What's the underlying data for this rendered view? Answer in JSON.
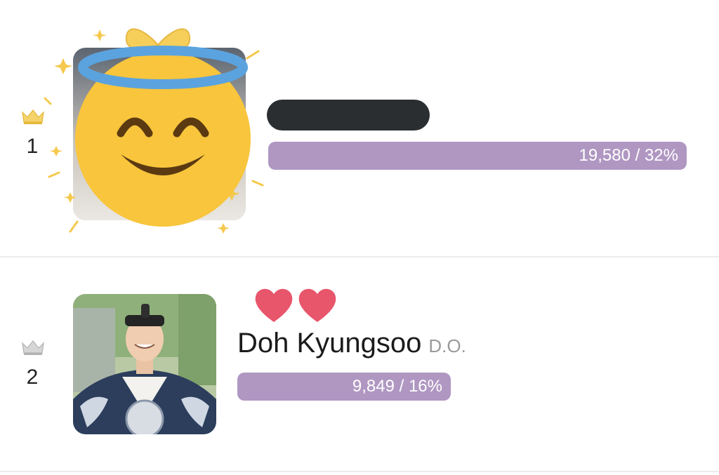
{
  "ranking": [
    {
      "rank": "1",
      "crown_icon": "gold-crown-icon",
      "crown_color": "#f2c94c",
      "name_hidden": true,
      "photo_overlay": "smiling-face-with-halo-emoji",
      "votes_text": "19,580 / 32%",
      "percent": 32
    },
    {
      "rank": "2",
      "crown_icon": "silver-crown-icon",
      "crown_color": "#c4c4c4",
      "name": "Doh Kyungsoo",
      "stage_name": "D.O.",
      "decoration": "two-hearts-icon",
      "votes_text": "9,849 / 16%",
      "percent": 16
    }
  ],
  "colors": {
    "bar": "#b097c2",
    "heart": "#e8566c",
    "redaction": "#2b2e30",
    "divider": "#ececec"
  }
}
